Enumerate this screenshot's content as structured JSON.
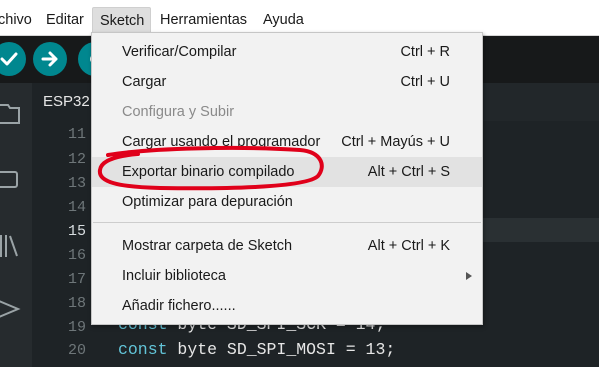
{
  "menubar": {
    "items": [
      {
        "label": "chivo"
      },
      {
        "label": "Editar"
      },
      {
        "label": "Sketch"
      },
      {
        "label": "Herramientas"
      },
      {
        "label": "Ayuda"
      }
    ]
  },
  "tabs": [
    {
      "label": "ESP32"
    }
  ],
  "toolbar": {
    "buttons": [
      "check-icon",
      "arrow-right-icon",
      "debug-icon"
    ]
  },
  "rail_icons": [
    "folder-icon",
    "board-icon",
    "library-icon",
    "debug-icon"
  ],
  "line_numbers": [
    "11",
    "12",
    "13",
    "14",
    "15",
    "16",
    "17",
    "18",
    "19",
    "20"
  ],
  "code_lines": [
    {
      "kw": "const",
      "text": " byte SD_SPI_SCK = 14;"
    },
    {
      "kw": "const",
      "text": " byte SD_SPI_MOSI = 13;"
    }
  ],
  "sketch_menu": {
    "items": [
      {
        "label": "Verificar/Compilar",
        "shortcut": "Ctrl + R"
      },
      {
        "label": "Cargar",
        "shortcut": "Ctrl + U"
      },
      {
        "label": "Configura y Subir",
        "shortcut": ""
      },
      {
        "label": "Cargar usando el programador",
        "shortcut": "Ctrl + Mayús + U"
      },
      {
        "label": "Exportar binario compilado",
        "shortcut": "Alt + Ctrl + S"
      },
      {
        "label": "Optimizar para depuración",
        "shortcut": ""
      },
      {
        "label": "Mostrar carpeta de Sketch",
        "shortcut": "Alt + Ctrl + K"
      },
      {
        "label": "Incluir biblioteca",
        "shortcut": ""
      },
      {
        "label": "Añadir fichero......",
        "shortcut": ""
      }
    ]
  },
  "colors": {
    "annotation": "#e0001a",
    "accent": "#00878f",
    "hover": "#e2e2e2"
  }
}
